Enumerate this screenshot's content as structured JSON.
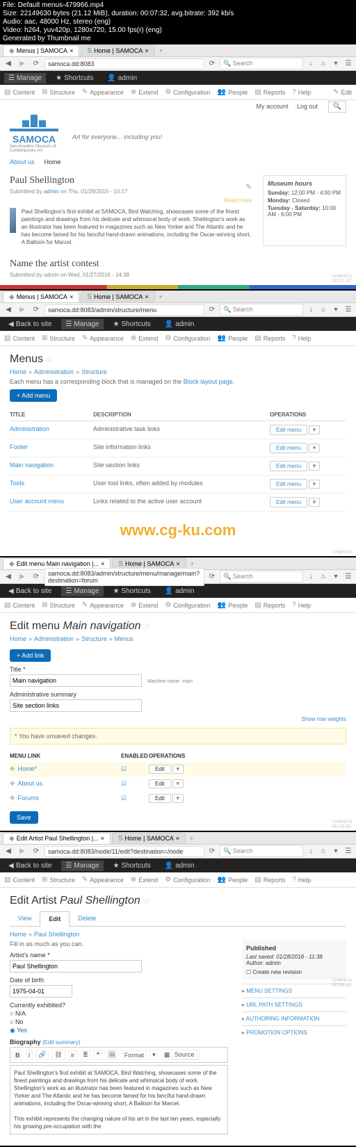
{
  "meta": {
    "l1": "File: Default menus-479966.mp4",
    "l2": "Size: 22149630 bytes (21.12 MiB), duration: 00:07:32, avg.bitrate: 392 kb/s",
    "l3": "Audio: aac, 48000 Hz, stereo (eng)",
    "l4": "Video: h264, yuv420p, 1280x720, 15.00 fps(r) (eng)",
    "l5": "Generated by Thumbnail me"
  },
  "browser": {
    "tab1": "Menus | SAMOCA",
    "tab2": "Home | SAMOCA",
    "tab3": "Edit menu Main navigation |...",
    "tab4": "Edit Artist Paul Shellington |...",
    "addr1": "samoca.dd:8083",
    "addr2": "samoca.dd:8083/admin/structure/menu",
    "addr3": "samoca.dd:8083/admin/structure/menu/manage/main?destination=forum",
    "addr4": "samoca.dd:8083/node/11/edit?destination=/node",
    "search": "Search"
  },
  "blackbar": {
    "back": "Back to site",
    "manage": "Manage",
    "shortcuts": "Shortcuts",
    "admin": "admin"
  },
  "toolbar": {
    "content": "Content",
    "structure": "Structure",
    "appearance": "Appearance",
    "extend": "Extend",
    "configuration": "Configuration",
    "people": "People",
    "reports": "Reports",
    "help": "Help",
    "edit": "Edit"
  },
  "pane1": {
    "myaccount": "My account",
    "logout": "Log out",
    "logo": "SAMOCA",
    "logosub": "San Anselmo Museum of Contemporary Art",
    "tagline": "Art for everyone... including you!",
    "nav1": "About us",
    "nav2": "Home",
    "art_title": "Paul Shellington",
    "byline_pre": "Submitted by ",
    "byline_auth": "admin",
    "byline_date": " on Thu, 01/28/2016 - 10:17",
    "readmore": "Read more",
    "body": "Paul Shellington's first exhibit at SAMOCA, Bird Watching, showcases some of the finest paintings and drawings from his delicate and whimsical body of work. Shellington's work as an illustrator has been featured in magazines such as New Yorker and The Atlantic and he has become famed for his fanciful hand-drawn animations, including the Oscar-winning short, A Balloon for Marcel.",
    "hours_t": "Museum hours",
    "hours1b": "Sunday:",
    "hours1": " 12:00 PM - 4:00 PM",
    "hours2b": "Monday:",
    "hours2": " Closed",
    "hours3b": "Tuesday - Saturday:",
    "hours3": " 10:00 AM - 6:00 PM",
    "art2_title": "Name the artist contest",
    "art2_byline": "Submitted by admin on Wed, 01/27/2016 - 14:38"
  },
  "pane2": {
    "title": "Menus",
    "crumb1": "Home",
    "crumb2": "Administration",
    "crumb3": "Structure",
    "note_pre": "Each menu has a corresponding block that is managed on the ",
    "note_link": "Block layout page",
    "addmenu": "+ Add menu",
    "h1": "TITLE",
    "h2": "DESCRIPTION",
    "h3": "OPERATIONS",
    "edit": "Edit menu",
    "rows": [
      {
        "t": "Administration",
        "d": "Administrative task links"
      },
      {
        "t": "Footer",
        "d": "Site information links"
      },
      {
        "t": "Main navigation",
        "d": "Site section links"
      },
      {
        "t": "Tools",
        "d": "User tool links, often added by modules"
      },
      {
        "t": "User account menu",
        "d": "Links related to the active user account"
      }
    ],
    "cgku": "www.cg-ku.com"
  },
  "pane3": {
    "title_pre": "Edit menu ",
    "title_em": "Main navigation",
    "crumb1": "Home",
    "crumb2": "Administration",
    "crumb3": "Structure",
    "crumb4": "Menus",
    "addlink": "+ Add link",
    "lbl_title": "Title *",
    "val_title": "Main navigation",
    "machine": "Machine name: main",
    "lbl_admin": "Administrative summary",
    "val_admin": "Site section links",
    "showwt": "Show row weights",
    "warn": "* You have unsaved changes.",
    "h1": "MENU LINK",
    "h2": "ENABLED",
    "h3": "OPERATIONS",
    "items": [
      {
        "t": "Home*"
      },
      {
        "t": "About us"
      },
      {
        "t": "Forums"
      }
    ],
    "edit": "Edit",
    "save": "Save"
  },
  "pane4": {
    "title_pre": "Edit Artist ",
    "title_em": "Paul Shellington",
    "tabs": {
      "view": "View",
      "edit": "Edit",
      "delete": "Delete"
    },
    "crumb1": "Home",
    "crumb2": "Paul Shellington",
    "instr": "Fill in as much as you can.",
    "lbl_name": "Artist's name *",
    "val_name": "Paul Shellington",
    "lbl_dob": "Date of birth",
    "val_dob": "1975-04-01",
    "lbl_exh": "Currently exhibited?",
    "opt_na": "N/A",
    "opt_no": "No",
    "opt_yes": "Yes",
    "lbl_bio": "Biography ",
    "editsum": "(Edit summary)",
    "rte": {
      "format": "Format",
      "source": "Source"
    },
    "body": "Paul Shellington's first exhibit at SAMOCA, Bird Watching, showcases some of the finest paintings and drawings from his delicate and whimsical body of work. Shellington's work as an illustrator has been featured in magazines such as New Yorker and The Atlantic and he has become famed for his fanciful hand-drawn animations, including the Oscar-winning short, A Balloon for Marcel.",
    "body2": "This exhibit represents the changing nature of his art in the last ten years, especially his growing pre-occupation with the",
    "pub_t": "Published",
    "pub_last": "Last saved: 01/28/2016 - 11:38",
    "pub_auth": "Author: admin",
    "pub_rev": "Create new revision",
    "sect1": "MENU SETTINGS",
    "sect2": "URL PATH SETTINGS",
    "sect3": "AUTHORING INFORMATION",
    "sect4": "PROMOTION OPTIONS"
  },
  "time": {
    "t1": "00:01:37",
    "t2": "00:03:50",
    "t3": "00:06:00"
  }
}
